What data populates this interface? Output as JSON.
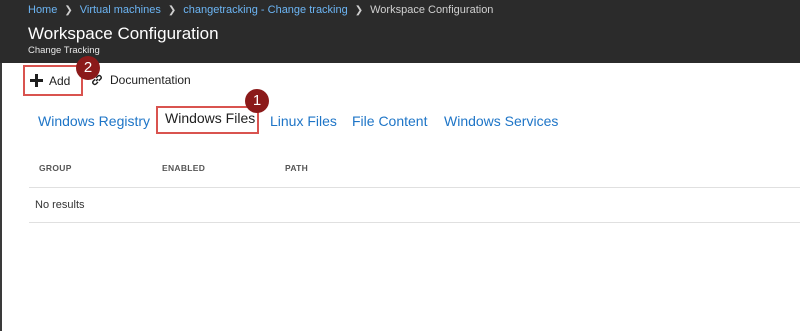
{
  "breadcrumb": {
    "items": [
      "Home",
      "Virtual machines",
      "changetracking - Change tracking",
      "Workspace Configuration"
    ]
  },
  "header": {
    "title": "Workspace Configuration",
    "subtitle": "Change Tracking"
  },
  "toolbar": {
    "add_label": "Add",
    "documentation_label": "Documentation"
  },
  "tabs": [
    {
      "label": "Windows Registry"
    },
    {
      "label": "Windows Files"
    },
    {
      "label": "Linux Files"
    },
    {
      "label": "File Content"
    },
    {
      "label": "Windows Services"
    }
  ],
  "table": {
    "columns": [
      "GROUP",
      "ENABLED",
      "PATH"
    ],
    "empty_text": "No results"
  },
  "callouts": [
    "1",
    "2"
  ],
  "colors": {
    "header_bg": "#2b2b2b",
    "link": "#1e75c7",
    "callout": "#8b1a1a",
    "highlight": "#d9534f"
  }
}
